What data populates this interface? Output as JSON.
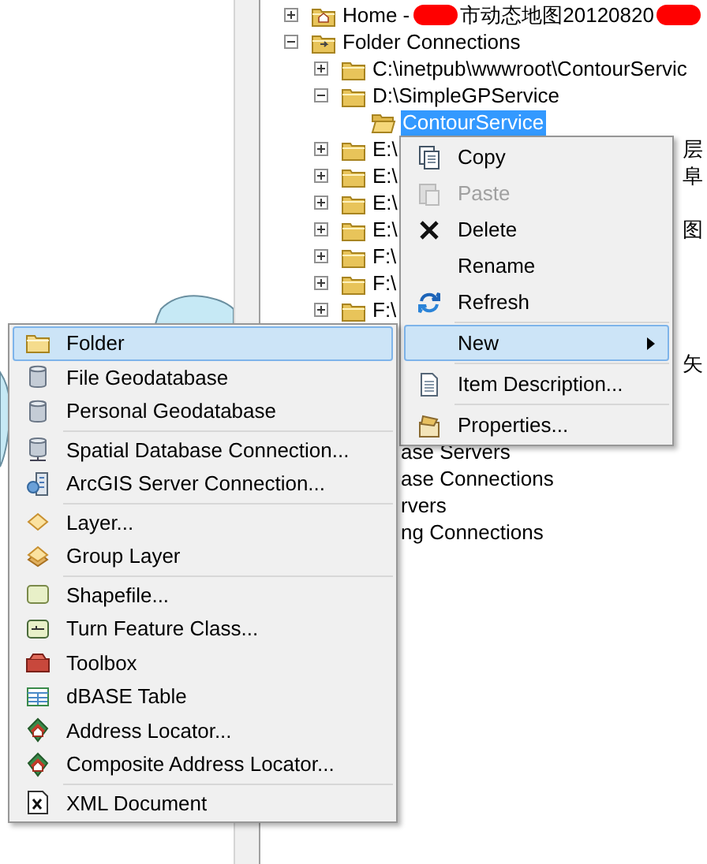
{
  "tree": {
    "items": [
      {
        "kind": "home",
        "expanded": false,
        "segments": [
          {
            "kind": "text",
            "text": "Home - "
          },
          {
            "kind": "redaction"
          },
          {
            "kind": "text",
            "text": "市动态地图20120820"
          },
          {
            "kind": "redaction"
          }
        ]
      },
      {
        "kind": "connections",
        "label": "Folder Connections",
        "expanded": true,
        "children": [
          {
            "kind": "folder",
            "label": "C:\\inetpub\\wwwroot\\ContourServic",
            "expanded": false
          },
          {
            "kind": "folder",
            "label": "D:\\SimpleGPService",
            "expanded": true,
            "children": [
              {
                "kind": "open-folder",
                "label": "ContourService",
                "selected": true
              }
            ]
          },
          {
            "kind": "folder",
            "label": "E:\\",
            "expanded": false,
            "tail": "层"
          },
          {
            "kind": "folder",
            "label": "E:\\",
            "expanded": false,
            "tail": "阜"
          },
          {
            "kind": "folder",
            "label": "E:\\",
            "expanded": false
          },
          {
            "kind": "folder",
            "label": "E:\\",
            "expanded": false,
            "tail": "图"
          },
          {
            "kind": "folder",
            "label": "F:\\",
            "expanded": false
          },
          {
            "kind": "folder",
            "label": "F:\\",
            "expanded": false
          },
          {
            "kind": "folder",
            "label": "F:\\",
            "expanded": false
          }
        ]
      }
    ],
    "lower_tail": "矢",
    "lower_items": [
      {
        "label": "ase Servers"
      },
      {
        "label": "ase Connections"
      },
      {
        "label": "rvers"
      },
      {
        "label": "ng Connections"
      }
    ]
  },
  "context_menu": {
    "groups": [
      [
        {
          "kind": "copy",
          "label": "Copy",
          "disabled": false,
          "selected": false
        },
        {
          "kind": "paste",
          "label": "Paste",
          "disabled": true,
          "selected": false
        },
        {
          "kind": "delete",
          "label": "Delete",
          "disabled": false,
          "selected": false
        },
        {
          "kind": "none",
          "label": "Rename",
          "disabled": false,
          "selected": false
        },
        {
          "kind": "refresh",
          "label": "Refresh",
          "disabled": false,
          "selected": false
        }
      ],
      [
        {
          "kind": "none",
          "label": "New",
          "disabled": false,
          "selected": true,
          "submenu": true
        }
      ],
      [
        {
          "kind": "document",
          "label": "Item Description...",
          "disabled": false,
          "selected": false
        }
      ],
      [
        {
          "kind": "properties",
          "label": "Properties...",
          "disabled": false,
          "selected": false
        }
      ]
    ]
  },
  "submenu": {
    "groups": [
      [
        {
          "kind": "folder",
          "label": "Folder",
          "selected": true
        },
        {
          "kind": "database",
          "label": "File Geodatabase",
          "selected": false
        },
        {
          "kind": "database",
          "label": "Personal Geodatabase",
          "selected": false
        }
      ],
      [
        {
          "kind": "db-connection",
          "label": "Spatial Database Connection...",
          "selected": false
        },
        {
          "kind": "server",
          "label": "ArcGIS Server Connection...",
          "selected": false
        }
      ],
      [
        {
          "kind": "layer",
          "label": "Layer...",
          "selected": false
        },
        {
          "kind": "group-layer",
          "label": "Group Layer",
          "selected": false
        }
      ],
      [
        {
          "kind": "shapefile",
          "label": "Shapefile...",
          "selected": false
        },
        {
          "kind": "feature-class",
          "label": "Turn Feature Class...",
          "selected": false
        },
        {
          "kind": "toolbox",
          "label": "Toolbox",
          "selected": false
        },
        {
          "kind": "table",
          "label": "dBASE Table",
          "selected": false
        },
        {
          "kind": "locator",
          "label": "Address Locator...",
          "selected": false
        },
        {
          "kind": "locator",
          "label": "Composite Address Locator...",
          "selected": false
        }
      ],
      [
        {
          "kind": "xml",
          "label": "XML Document",
          "selected": false
        }
      ]
    ]
  }
}
